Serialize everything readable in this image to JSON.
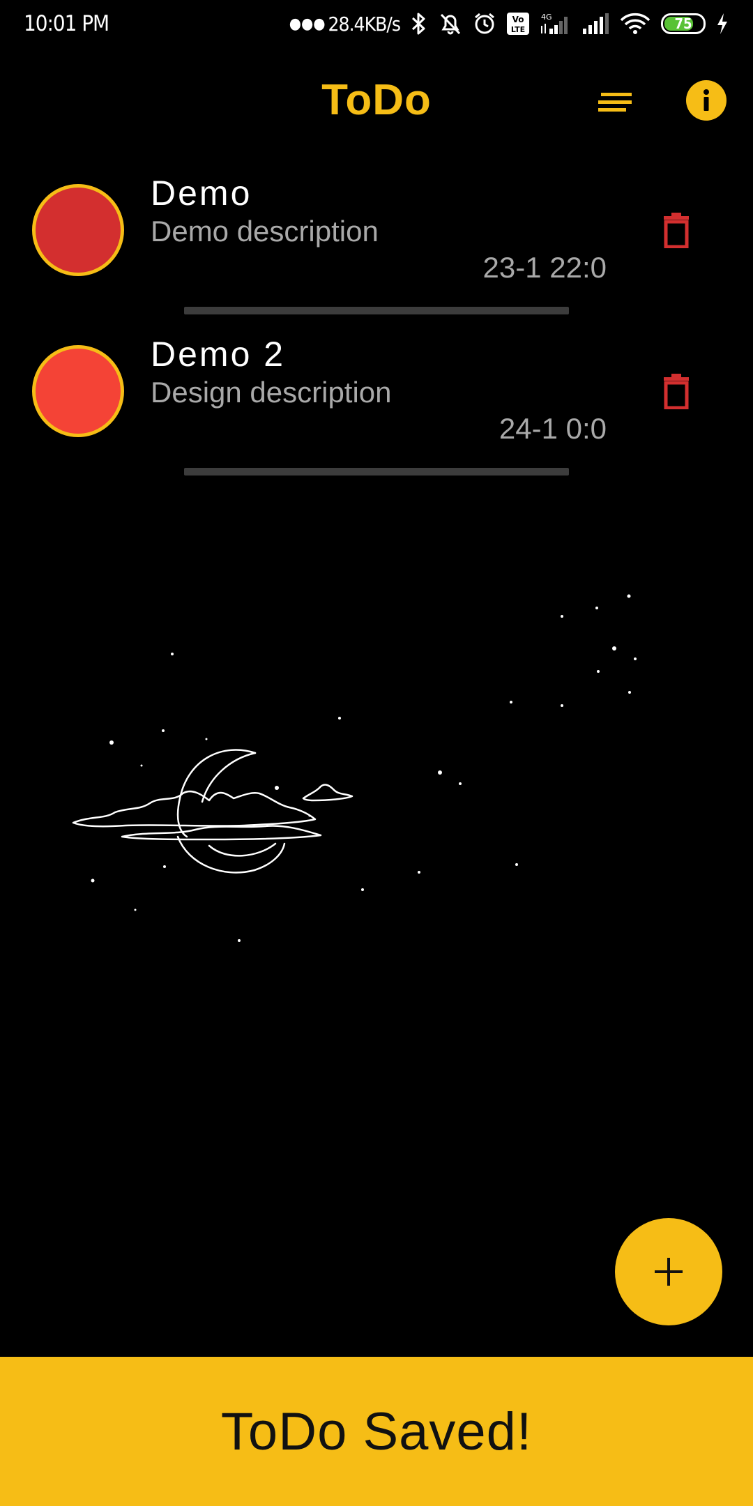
{
  "status_bar": {
    "time": "10:01 PM",
    "network_speed": "28.4KB/s",
    "battery_level": "75",
    "battery_fraction": 0.75,
    "icons": [
      "bluetooth-icon",
      "bell-off-icon",
      "alarm-icon",
      "volte-icon",
      "signal-4g-icon",
      "signal-icon",
      "wifi-icon",
      "battery-icon",
      "charging-icon"
    ]
  },
  "app_bar": {
    "title": "ToDo",
    "sort_icon": "sort-icon",
    "info_icon": "info-icon"
  },
  "todos": [
    {
      "title": "Demo",
      "description": "Demo description",
      "date": "23-1 22:0",
      "color": "#d32f2f"
    },
    {
      "title": "Demo 2",
      "description": "Design description",
      "date": "24-1 0:0",
      "color": "#f44336"
    }
  ],
  "fab": {
    "icon": "plus-icon",
    "label": "+"
  },
  "snackbar": {
    "message": "ToDo Saved!"
  },
  "colors": {
    "accent": "#f6bd16",
    "background": "#000000",
    "delete": "#d32f2f",
    "secondary_text": "#a9a9a9"
  }
}
